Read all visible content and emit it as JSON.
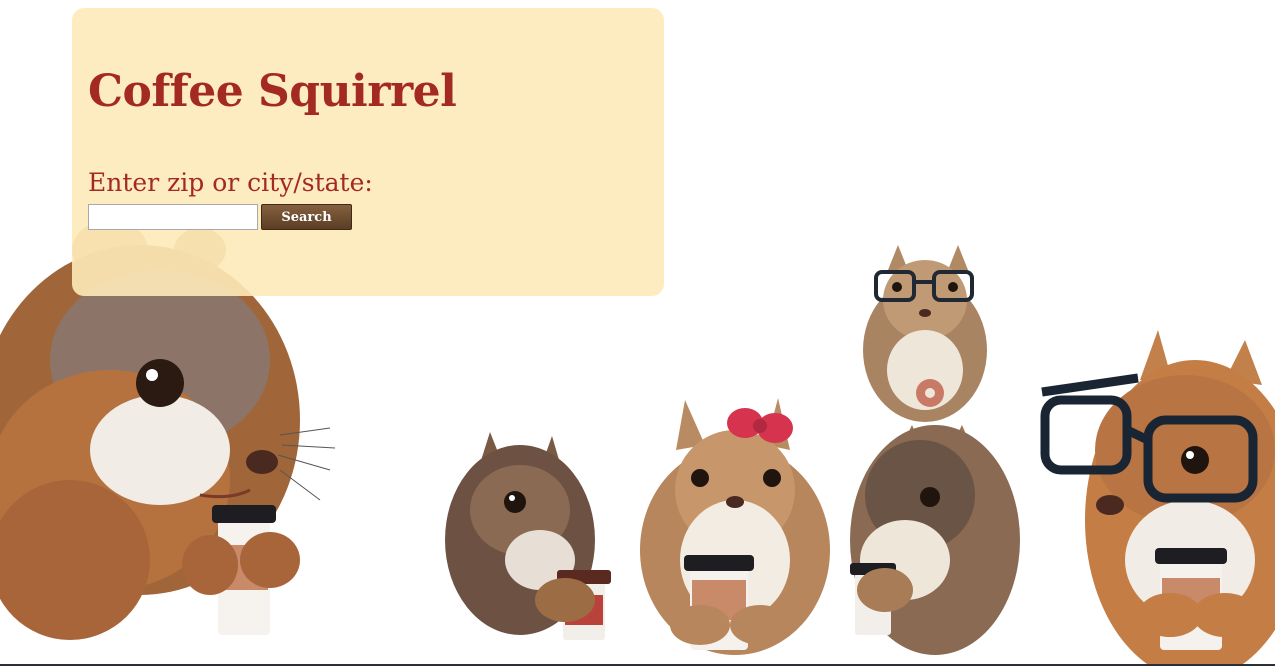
{
  "site": {
    "title": "Coffee Squirrel"
  },
  "search": {
    "prompt": "Enter zip or city/state:",
    "value": "",
    "placeholder": "",
    "button_label": "Search"
  },
  "colors": {
    "title": "#a32a23",
    "panel": "#fdeab8",
    "button": "#6b4a2e"
  },
  "illustration": {
    "subject": "watercolor squirrels holding coffee cups"
  }
}
